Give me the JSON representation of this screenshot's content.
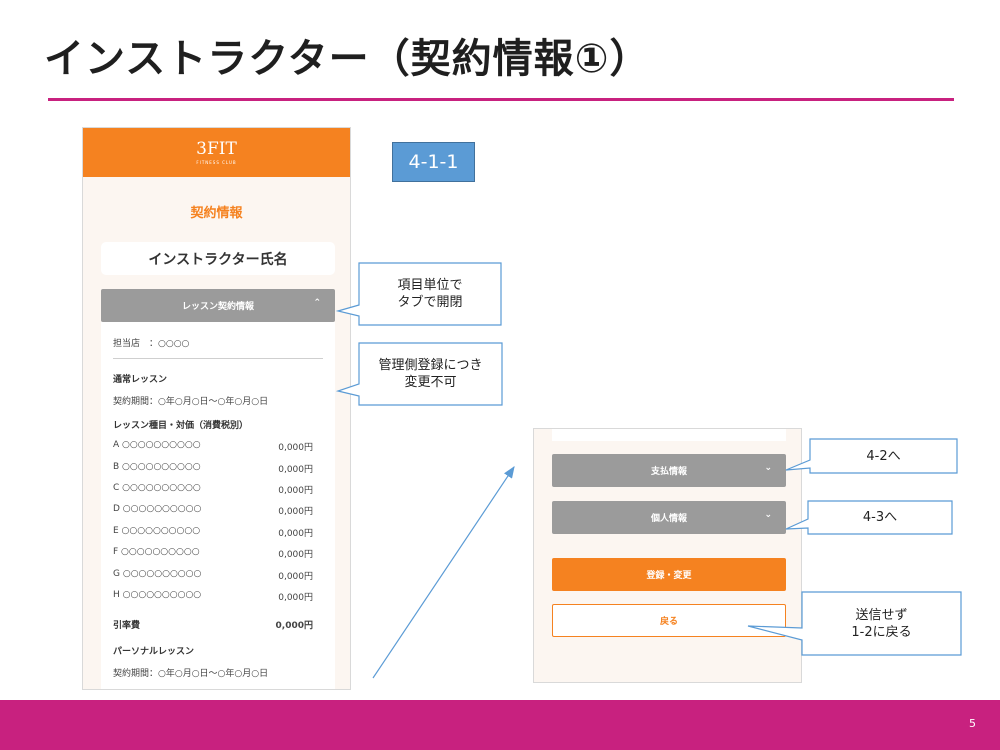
{
  "slide": {
    "title": "インストラクター（契約情報①）",
    "page_number": "5"
  },
  "colors": {
    "accent_orange": "#f58220",
    "magenta": "#c8217f",
    "callout_blue": "#5b9bd5",
    "accordion_gray": "#9b9b9b"
  },
  "screen_id": "4-1-1",
  "left_screen": {
    "logo": "3FIT",
    "logo_sub": "FITNESS CLUB",
    "title": "契約情報",
    "instructor_name": "インストラクター氏名",
    "accordion_label": "レッスン契約情報",
    "accordion_icon": "chevron-up-icon",
    "store": "担当店　：○○○○",
    "regular_heading": "通常レッスン",
    "regular_period": "契約期間：○年○月○日～○年○月○日",
    "lesson_heading": "レッスン種目・対価（消費税別）",
    "lessons": [
      {
        "name": "A ○○○○○○○○○○",
        "price": "0,000円"
      },
      {
        "name": "B ○○○○○○○○○○",
        "price": "0,000円"
      },
      {
        "name": "C ○○○○○○○○○○",
        "price": "0,000円"
      },
      {
        "name": "D ○○○○○○○○○○",
        "price": "0,000円"
      },
      {
        "name": "E ○○○○○○○○○○",
        "price": "0,000円"
      },
      {
        "name": "F ○○○○○○○○○○",
        "price": "0,000円"
      },
      {
        "name": "G ○○○○○○○○○○",
        "price": "0,000円"
      },
      {
        "name": "H ○○○○○○○○○○",
        "price": "0,000円"
      }
    ],
    "deduction_label": "引率費",
    "deduction_price": "0,000円",
    "personal_heading": "パーソナルレッスン",
    "personal_period": "契約期間：○年○月○日～○年○月○日"
  },
  "right_screen": {
    "payment_label": "支払情報",
    "personal_info_label": "個人情報",
    "accordion_icon": "chevron-down-icon",
    "register_label": "登録・変更",
    "back_label": "戻る"
  },
  "callouts": {
    "tab_toggle_line1": "項目単位で",
    "tab_toggle_line2": "タブで開閉",
    "admin_line1": "管理側登録につき",
    "admin_line2": "変更不可",
    "to_4_2": "4-2へ",
    "to_4_3": "4-3へ",
    "back_line1": "送信せず",
    "back_line2": "1-2に戻る"
  }
}
